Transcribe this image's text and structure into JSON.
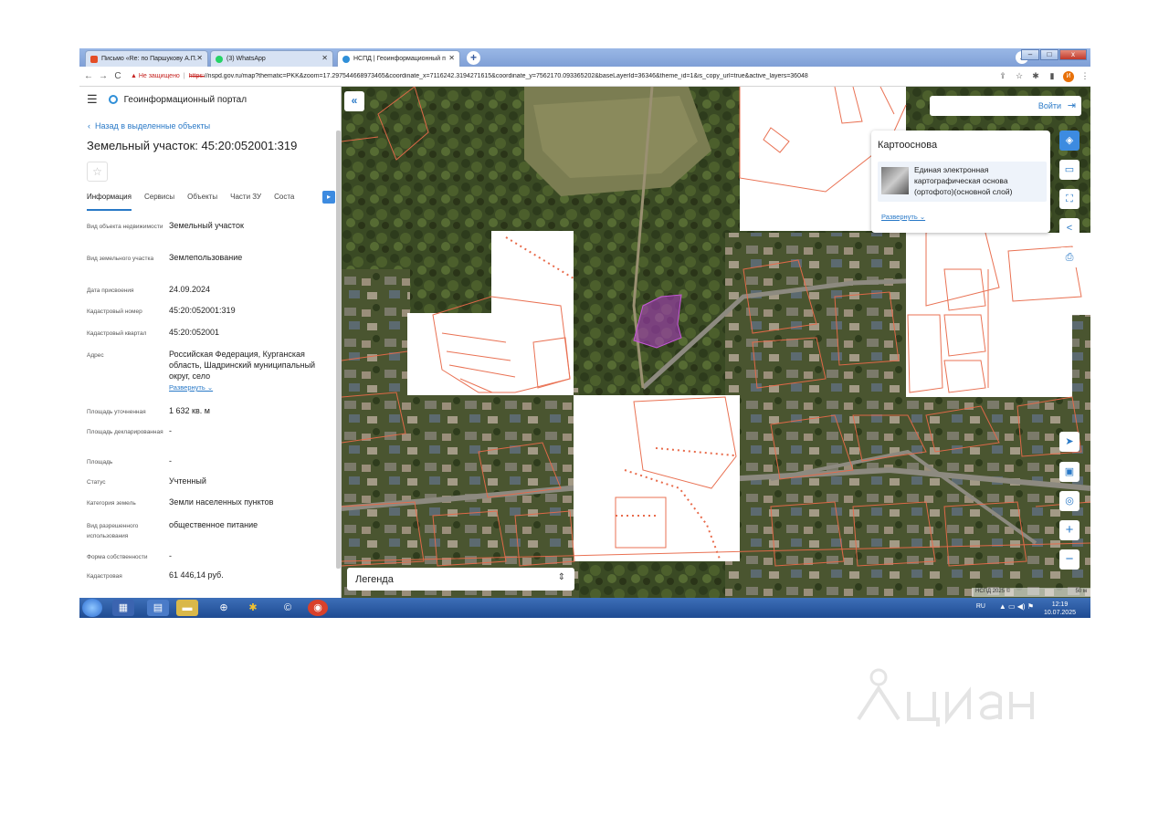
{
  "browser": {
    "tabs": [
      {
        "label": "Письмо «Re: по Паршукову А.П.",
        "icon_color": "#e44d26"
      },
      {
        "label": "(3) WhatsApp",
        "icon_color": "#25d366"
      },
      {
        "label": "НСПД | Геоинформационный п",
        "icon_color": "#2f8fd8"
      }
    ],
    "new_tab": "+",
    "profile": "v",
    "window_buttons": [
      "–",
      "□",
      "x"
    ],
    "nav": {
      "back": "←",
      "forward": "→",
      "reload": "C"
    },
    "security_warning": "▲ Не защищено",
    "url_scheme": "https:",
    "url": "//nspd.gov.ru/map?thematic=PKK&zoom=17.297544668973465&coordinate_x=7116242.3194271615&coordinate_y=7562170.093365202&baseLayerId=36346&theme_id=1&is_copy_url=true&active_layers=36048",
    "avatar_letter": "И"
  },
  "portal": {
    "title": "Геоинформационный портал",
    "back_link": "Назад в выделенные объекты",
    "parcel_title": "Земельный участок: 45:20:052001:319",
    "tabs": [
      "Информация",
      "Сервисы",
      "Объекты",
      "Части ЗУ",
      "Соста"
    ],
    "attributes": [
      {
        "key": "Вид объекта недвижимости",
        "value": "Земельный участок"
      },
      {
        "key": "Вид земельного участка",
        "value": "Землепользование"
      },
      {
        "key": "Дата присвоения",
        "value": "24.09.2024"
      },
      {
        "key": "Кадастровый номер",
        "value": "45:20:052001:319"
      },
      {
        "key": "Кадастровый квартал",
        "value": "45:20:052001"
      },
      {
        "key": "Адрес",
        "value": "Российская Федерация, Курганская область, Шадринский муниципальный округ, село",
        "expand": "Развернуть ⌄"
      },
      {
        "key": "Площадь уточненная",
        "value": "1 632 кв. м"
      },
      {
        "key": "Площадь декларированная",
        "value": "-"
      },
      {
        "key": "Площадь",
        "value": "-"
      },
      {
        "key": "Статус",
        "value": "Учтенный"
      },
      {
        "key": "Категория земель",
        "value": "Земли населенных пунктов"
      },
      {
        "key": "Вид разрешенного использования",
        "value": "общественное питание"
      },
      {
        "key": "Форма собственности",
        "value": "-"
      },
      {
        "key": "Кадастровая",
        "value": "61 446,14 руб."
      }
    ]
  },
  "map": {
    "collapse": "«",
    "login": "Войти",
    "basemap": {
      "title": "Картооснова",
      "layer": "Единая электронная картографическая основа (ортофото)(основной слой)",
      "expand": "Развернуть ⌄"
    },
    "legend": "Легенда",
    "legend_toggle": "⌃⌄",
    "footer_left": "НСПД 2025 ©",
    "footer_right": "50 м",
    "parcel_line_color": "#e86a4a",
    "highlight_color": "#b03cc8",
    "tools": [
      "layers-icon",
      "ruler-icon",
      "select-area-icon",
      "share-icon",
      "print-icon",
      "locate-icon",
      "minimap-icon",
      "position-icon",
      "zoom-in-icon",
      "zoom-out-icon"
    ]
  },
  "taskbar": {
    "lang": "RU",
    "time": "12:19",
    "date": "10.07.2025"
  },
  "watermark": "циан"
}
